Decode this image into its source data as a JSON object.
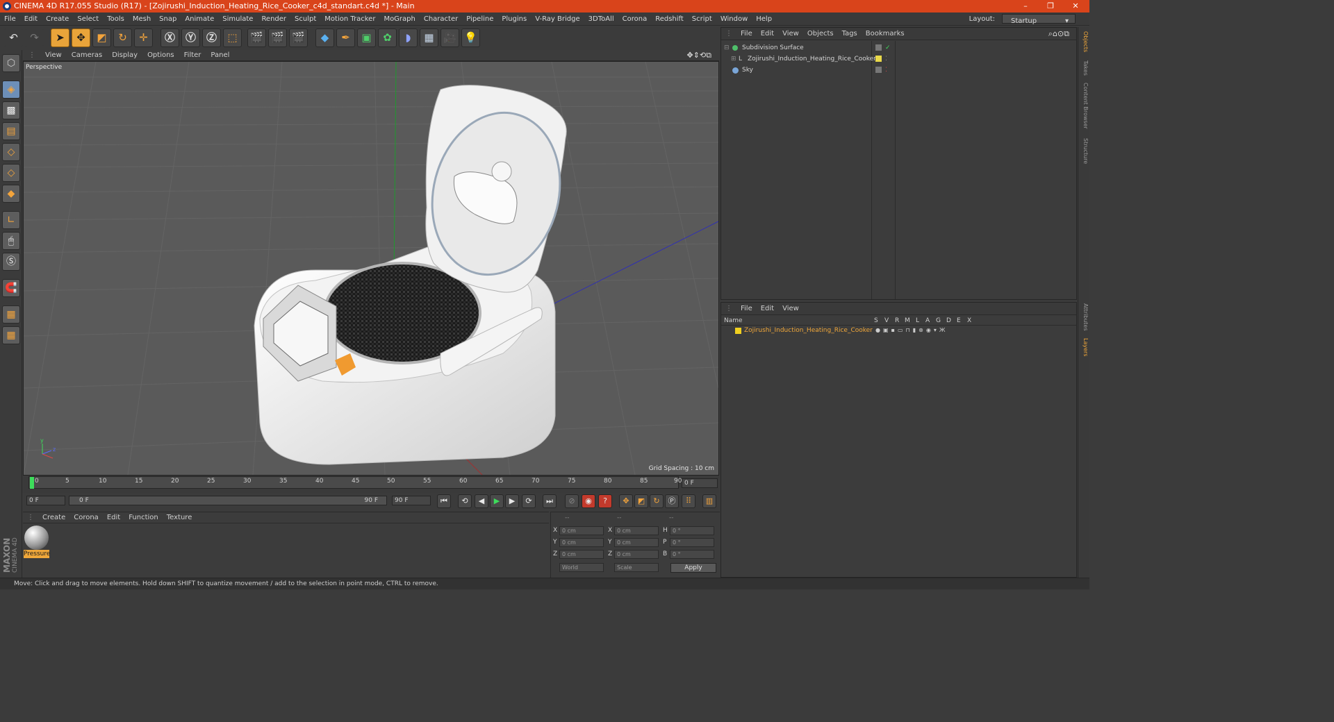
{
  "window": {
    "title": "CINEMA 4D R17.055 Studio (R17) - [Zojirushi_Induction_Heating_Rice_Cooker_c4d_standart.c4d *] - Main",
    "controls": [
      "–",
      "❐",
      "✕"
    ]
  },
  "menubar": {
    "items": [
      "File",
      "Edit",
      "Create",
      "Select",
      "Tools",
      "Mesh",
      "Snap",
      "Animate",
      "Simulate",
      "Render",
      "Sculpt",
      "Motion Tracker",
      "MoGraph",
      "Character",
      "Pipeline",
      "Plugins",
      "V-Ray Bridge",
      "3DToAll",
      "Corona",
      "Redshift",
      "Script",
      "Window",
      "Help"
    ],
    "layout_label": "Layout:",
    "layout_value": "Startup"
  },
  "viewport": {
    "menu": [
      "View",
      "Cameras",
      "Display",
      "Options",
      "Filter",
      "Panel"
    ],
    "camera_label": "Perspective",
    "grid_spacing": "Grid Spacing : 10 cm"
  },
  "timeline": {
    "ticks": [
      "0",
      "5",
      "10",
      "15",
      "20",
      "25",
      "30",
      "35",
      "40",
      "45",
      "50",
      "55",
      "60",
      "65",
      "70",
      "75",
      "80",
      "85",
      "90"
    ],
    "current_frame": "0 F",
    "start_frame": "0 F",
    "range_start": "0 F",
    "range_end": "90 F",
    "end_frame": "90 F"
  },
  "material_manager": {
    "menu": [
      "Create",
      "Corona",
      "Edit",
      "Function",
      "Texture"
    ],
    "materials": [
      {
        "name": "Pressure"
      }
    ]
  },
  "coordinates": {
    "headers": [
      "--",
      "--",
      "--"
    ],
    "rows": [
      {
        "a_label": "X",
        "a": "0 cm",
        "b_label": "X",
        "b": "0 cm",
        "c_label": "H",
        "c": "0 °"
      },
      {
        "a_label": "Y",
        "a": "0 cm",
        "b_label": "Y",
        "b": "0 cm",
        "c_label": "P",
        "c": "0 °"
      },
      {
        "a_label": "Z",
        "a": "0 cm",
        "b_label": "Z",
        "b": "0 cm",
        "c_label": "B",
        "c": "0 °"
      }
    ],
    "space": "World",
    "mode": "Scale",
    "apply_label": "Apply"
  },
  "object_manager": {
    "menu": [
      "File",
      "Edit",
      "View",
      "Objects",
      "Tags",
      "Bookmarks"
    ],
    "objects": [
      {
        "name": "Subdivision Surface",
        "color": "#4fbf6a"
      },
      {
        "name": "Zojirushi_Induction_Heating_Rice_Cooker",
        "color": "#e9d94a"
      },
      {
        "name": "Sky",
        "color": "#7aa6d8"
      }
    ]
  },
  "layer_manager": {
    "menu": [
      "File",
      "Edit",
      "View"
    ],
    "columns": [
      "Name",
      "S",
      "V",
      "R",
      "M",
      "L",
      "A",
      "G",
      "D",
      "E",
      "X"
    ],
    "layers": [
      {
        "name": "Zojirushi_Induction_Heating_Rice_Cooker",
        "color": "#f0a73a"
      }
    ]
  },
  "side_tabs": [
    "Objects",
    "Takes",
    "Content Browser",
    "Structure",
    "Attributes",
    "Layers"
  ],
  "status_bar": "Move: Click and drag to move elements. Hold down SHIFT to quantize movement / add to the selection in point mode, CTRL to remove.",
  "branding": [
    "MAXON",
    "CINEMA 4D"
  ]
}
